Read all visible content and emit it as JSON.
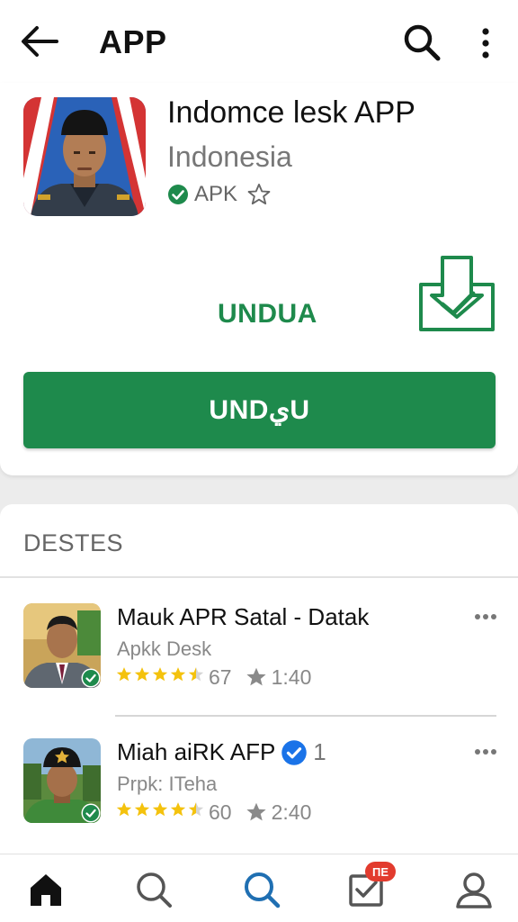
{
  "topbar": {
    "title": "APP",
    "back_icon": "arrow-left-icon",
    "search_icon": "search-icon",
    "more_icon": "more-vertical-icon"
  },
  "app": {
    "name": "Indomce lesk APP",
    "developer": "Indonesia",
    "badge": "APK",
    "verified_icon": "check-circle-icon",
    "favorite_icon": "star-outline-icon",
    "download_label": "UNDUA",
    "download_icon": "download-check-icon",
    "primary_button_label": "UNDيU"
  },
  "list": {
    "header": "DESTES",
    "items": [
      {
        "title": "Mauk APR Satal - Datak",
        "subtitle": "Apkk Desk",
        "rating_value": "67",
        "rating_stars": 4.5,
        "extra": "1:40",
        "verified_title": false,
        "title_suffix": ""
      },
      {
        "title": "Miah aiRK AFP",
        "subtitle": "Prpk: ITeha",
        "rating_value": "60",
        "rating_stars": 4.5,
        "extra": "2:40",
        "verified_title": true,
        "title_suffix": "1"
      }
    ]
  },
  "bottom_nav": {
    "items": [
      "home-icon",
      "search-icon",
      "search-active-icon",
      "checklist-icon",
      "profile-icon"
    ],
    "badge": "ПЕ"
  },
  "colors": {
    "accent_green": "#1e8a4c",
    "star_yellow": "#f4c20d",
    "verified_blue": "#1a73e8",
    "active_nav_blue": "#1f6fb2",
    "badge_red": "#e23b2e"
  }
}
